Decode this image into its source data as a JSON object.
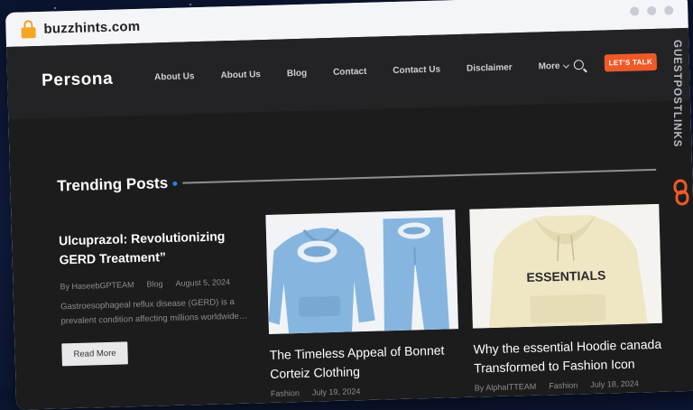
{
  "browser": {
    "url": "buzzhints.com"
  },
  "site": {
    "logo": "Persona",
    "nav": [
      {
        "label": "About Us"
      },
      {
        "label": "About Us"
      },
      {
        "label": "Blog"
      },
      {
        "label": "Contact"
      },
      {
        "label": "Contact Us"
      },
      {
        "label": "Disclaimer"
      },
      {
        "label": "More"
      }
    ],
    "cta_label": "LET'S TALK",
    "section_title": "Trending Posts"
  },
  "posts": [
    {
      "title": "Ulcuprazol: Revolutionizing GERD Treatment”",
      "author": "By HaseebGPTEAM",
      "category": "Blog",
      "date": "August 5, 2024",
      "excerpt": "Gastroesophageal reflux disease (GERD) is a prevalent condition affecting millions worldwide…",
      "read_more": "Read More"
    },
    {
      "title": "The Timeless Appeal of Bonnet Corteiz Clothing",
      "author": "",
      "category": "Fashion",
      "date": "July 19, 2024"
    },
    {
      "title": "Why the essential Hoodie canada Transformed to Fashion Icon",
      "author": "By AlphaITTEAM",
      "category": "Fashion",
      "date": "July 18, 2024",
      "image_text": "ESSENTIALS"
    }
  ],
  "watermark": "GUESTPOSTLINKS",
  "colors": {
    "accent": "#ee5a28",
    "bullet": "#2f7de1",
    "lock": "#f5a623"
  }
}
